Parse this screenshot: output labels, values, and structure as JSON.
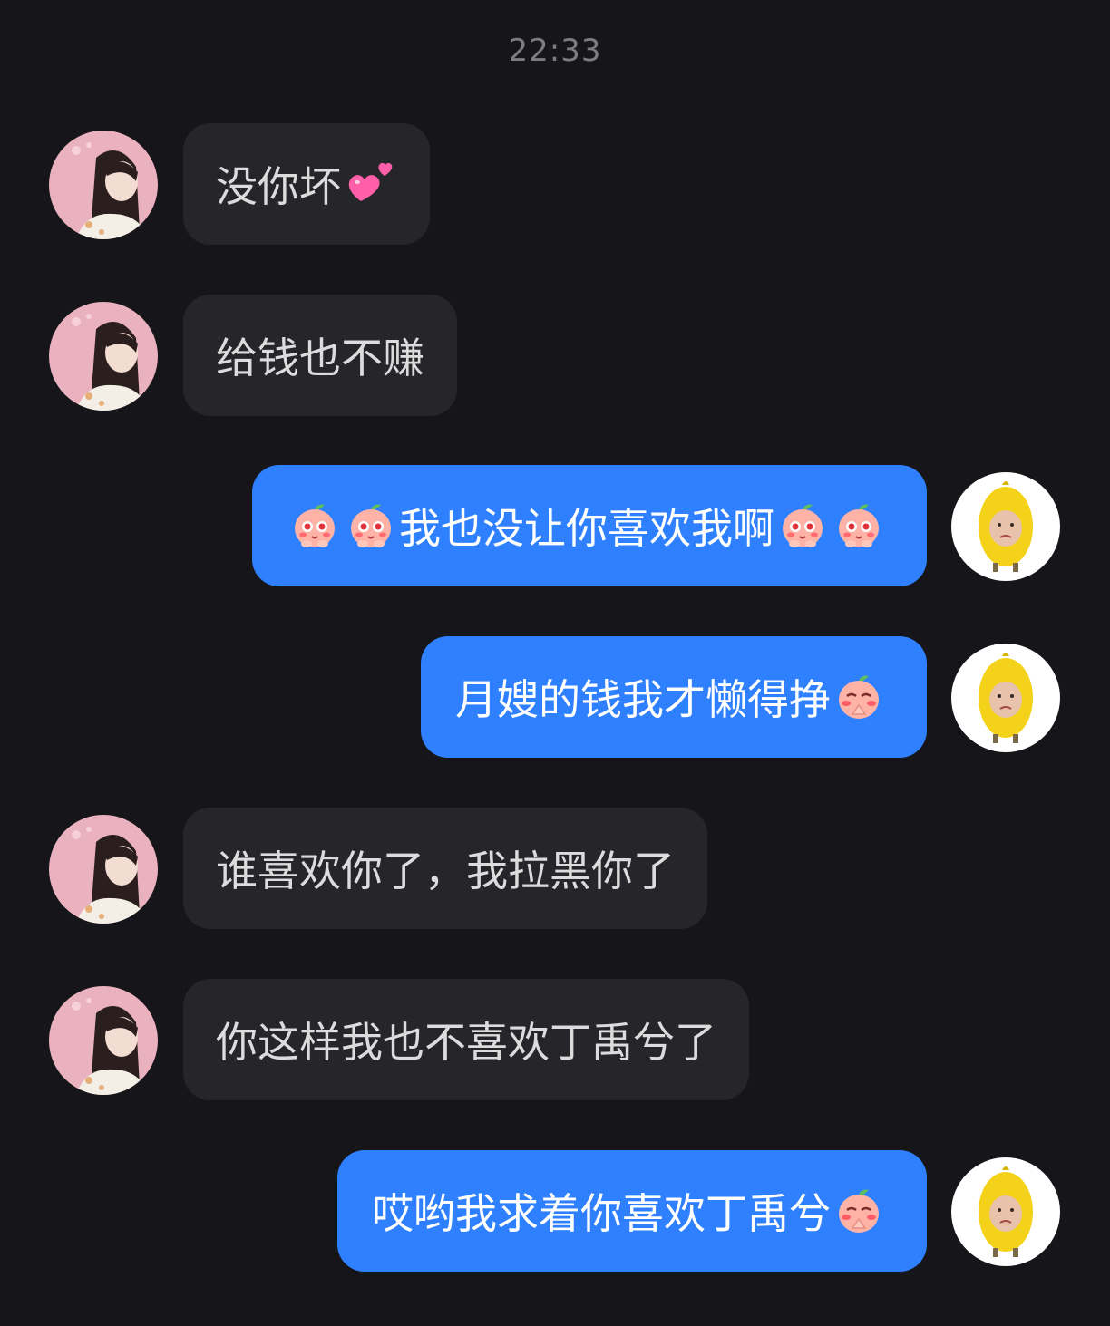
{
  "header": {
    "timestamp": "22:33"
  },
  "messages": [
    {
      "side": "incoming",
      "text": "没你坏",
      "trailing_icon": "two-hearts-icon"
    },
    {
      "side": "incoming",
      "text": "给钱也不赚"
    },
    {
      "side": "outgoing",
      "text": "我也没让你喜欢我啊",
      "leading_icons": [
        "peach-blush-emoji",
        "peach-blush-emoji"
      ],
      "trailing_icons": [
        "peach-blush-emoji",
        "peach-blush-emoji"
      ]
    },
    {
      "side": "outgoing",
      "text": "月嫂的钱我才懒得挣",
      "trailing_icons": [
        "peach-pray-emoji"
      ]
    },
    {
      "side": "incoming",
      "text": "谁喜欢你了，我拉黑你了"
    },
    {
      "side": "incoming",
      "text": "你这样我也不喜欢丁禹兮了"
    },
    {
      "side": "outgoing",
      "text": "哎哟我求着你喜欢丁禹兮",
      "trailing_icons": [
        "peach-pray-emoji"
      ]
    }
  ],
  "avatars": {
    "incoming": "girl-avatar",
    "outgoing": "lemon-head-avatar"
  },
  "colors": {
    "background": "#16161a",
    "incoming_bubble": "#25252a",
    "outgoing_bubble": "#2f80ff",
    "timestamp": "#7c7c82"
  }
}
